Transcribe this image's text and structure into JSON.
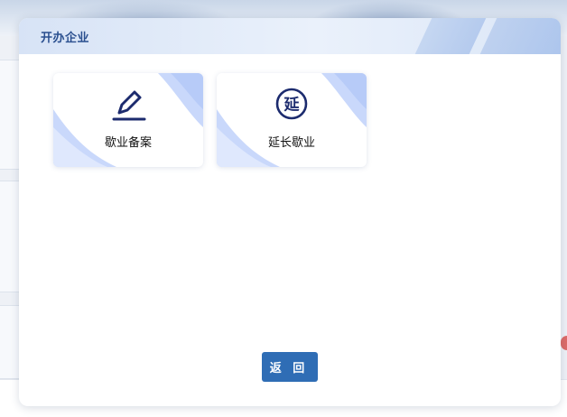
{
  "modal": {
    "title": "开办企业",
    "cards": [
      {
        "label": "歇业备案",
        "icon": "pen-edit-icon"
      },
      {
        "label": "延长歇业",
        "icon": "yan-circle-icon",
        "icon_glyph": "延"
      }
    ],
    "back_label": "返 回"
  },
  "colors": {
    "accent": "#2f6db5",
    "title": "#2a4f8f",
    "icon": "#1c2b6e"
  }
}
